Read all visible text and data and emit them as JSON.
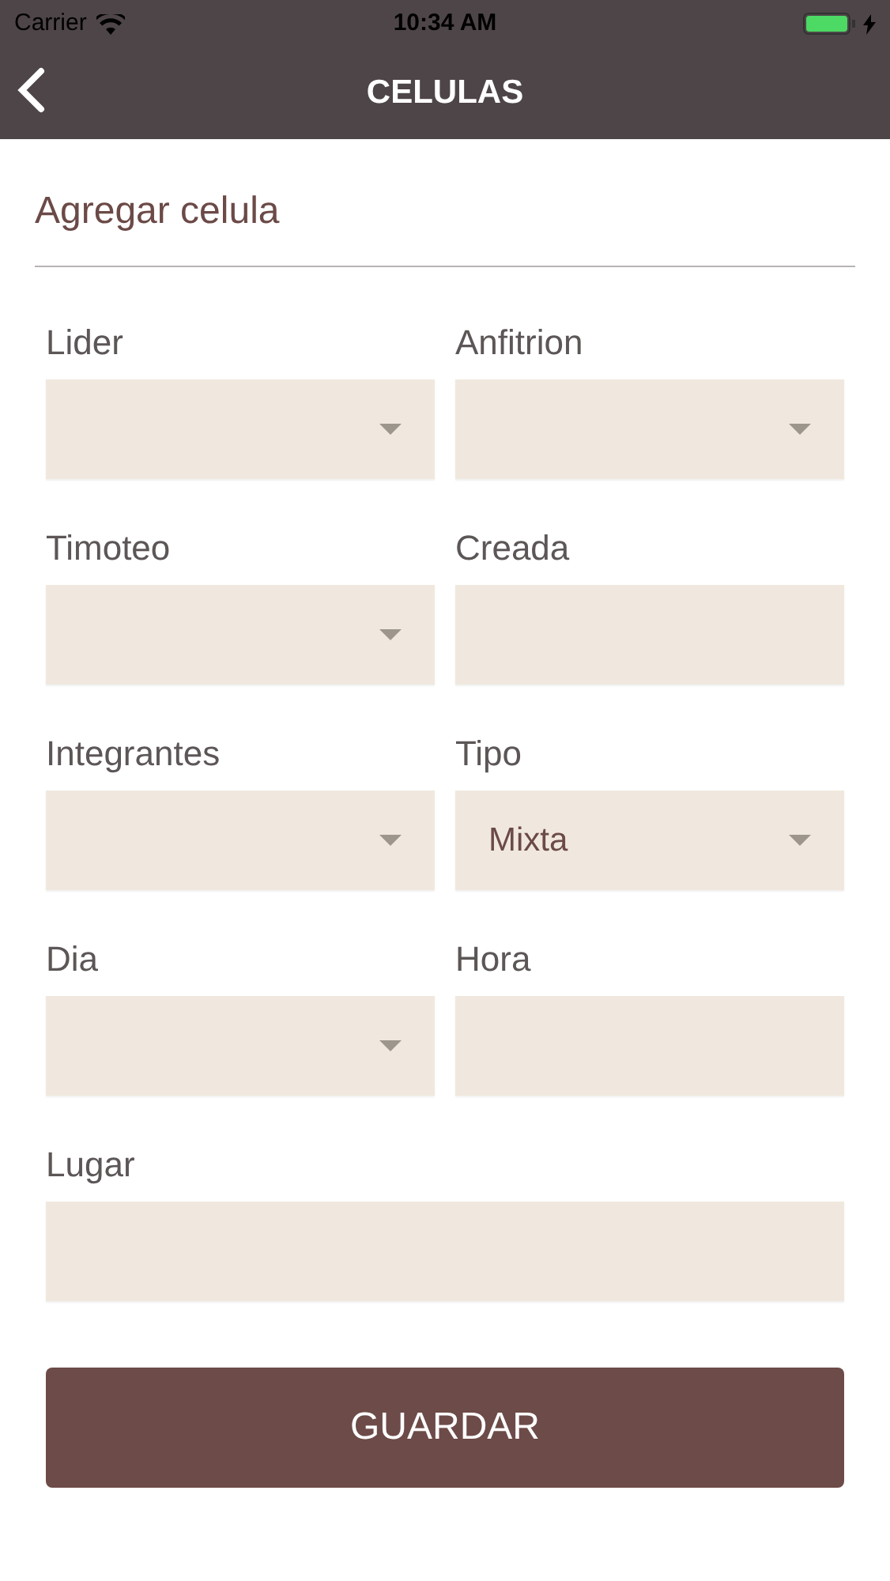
{
  "status_bar": {
    "carrier": "Carrier",
    "time": "10:34 AM"
  },
  "nav": {
    "title": "CELULAS"
  },
  "form_title": "Agregar celula",
  "fields": [
    {
      "label": "Lider",
      "kind": "select"
    },
    {
      "label": "Anfitrion",
      "kind": "select"
    },
    {
      "label": "Timoteo",
      "kind": "select"
    },
    {
      "label": "Creada",
      "kind": "text"
    },
    {
      "label": "Integrantes",
      "kind": "select"
    },
    {
      "label": "Tipo",
      "kind": "select",
      "value": "Mixta"
    },
    {
      "label": "Dia",
      "kind": "select"
    },
    {
      "label": "Hora",
      "kind": "text"
    },
    {
      "label": "Lugar",
      "kind": "text",
      "wide": true
    }
  ],
  "submit": "GUARDAR"
}
